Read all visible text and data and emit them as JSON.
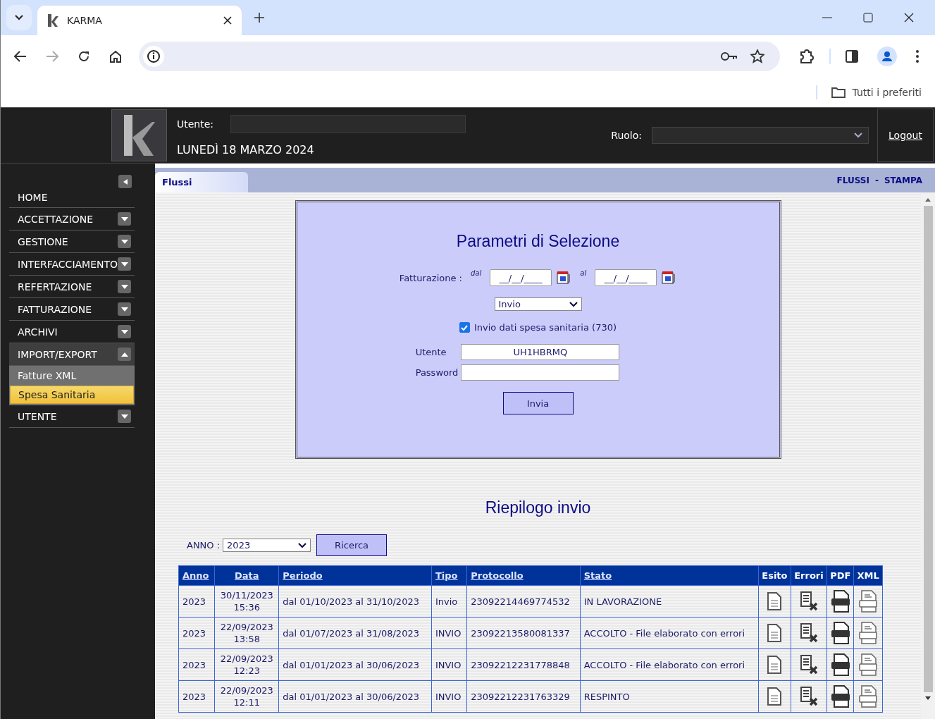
{
  "browser": {
    "tab_title": "KARMA",
    "bookmarks_label": "Tutti i preferiti"
  },
  "header": {
    "user_label": "Utente:",
    "date": "LUNEDÌ 18 MARZO 2024",
    "role_label": "Ruolo:",
    "logout": "Logout"
  },
  "sidebar": {
    "items": [
      {
        "label": "HOME",
        "kind": "link"
      },
      {
        "label": "ACCETTAZIONE",
        "kind": "menu",
        "expanded": false
      },
      {
        "label": "GESTIONE",
        "kind": "menu",
        "expanded": false
      },
      {
        "label": "INTERFACCIAMENTO",
        "kind": "menu",
        "expanded": false
      },
      {
        "label": "REFERTAZIONE",
        "kind": "menu",
        "expanded": false
      },
      {
        "label": "FATTURAZIONE",
        "kind": "menu",
        "expanded": false
      },
      {
        "label": "ARCHIVI",
        "kind": "menu",
        "expanded": false
      },
      {
        "label": "IMPORT/EXPORT",
        "kind": "menu",
        "expanded": true,
        "children": [
          {
            "label": "Fatture XML",
            "selected": false
          },
          {
            "label": "Spesa Sanitaria",
            "selected": true
          }
        ]
      },
      {
        "label": "UTENTE",
        "kind": "menu",
        "expanded": false
      }
    ]
  },
  "tabs": [
    {
      "label": "Flussi",
      "selected": true
    }
  ],
  "top_links": {
    "items": [
      "FLUSSI",
      "STAMPA"
    ],
    "separator": "-"
  },
  "form": {
    "title": "Parametri di Selezione",
    "billing_label": "Fatturazione :",
    "from_label": "dal",
    "from_value": "__/__/____",
    "to_label": "al",
    "to_value": "__/__/____",
    "type_value": "Invio",
    "checkbox": {
      "label": "Invio dati spesa sanitaria (730)",
      "checked": true
    },
    "user_label": "Utente",
    "user_value": "UH1HBRMQ",
    "password_label": "Password",
    "submit": "Invia"
  },
  "summary": {
    "title": "Riepilogo invio",
    "year_label": "ANNO :",
    "year_value": "2023",
    "search_button": "Ricerca",
    "table": {
      "columns": [
        {
          "label": "Anno",
          "kind": "sort"
        },
        {
          "label": "Data",
          "kind": "sort"
        },
        {
          "label": "Periodo",
          "kind": "sort"
        },
        {
          "label": "Tipo",
          "kind": "sort"
        },
        {
          "label": "Protocollo",
          "kind": "sort"
        },
        {
          "label": "Stato",
          "kind": "sort"
        },
        {
          "label": "Esito",
          "kind": "plain"
        },
        {
          "label": "Errori",
          "kind": "plain"
        },
        {
          "label": "PDF",
          "kind": "plain"
        },
        {
          "label": "XML",
          "kind": "plain"
        }
      ],
      "rows": [
        {
          "anno": "2023",
          "date": "30/11/2023",
          "time": "15:36",
          "periodo": "dal 01/10/2023 al 31/10/2023",
          "tipo": "Invio",
          "protocollo": "23092214469774532",
          "stato": "IN LAVORAZIONE"
        },
        {
          "anno": "2023",
          "date": "22/09/2023",
          "time": "13:58",
          "periodo": "dal 01/07/2023 al 31/08/2023",
          "tipo": "INVIO",
          "protocollo": "23092213580081337",
          "stato": "ACCOLTO - File elaborato con errori"
        },
        {
          "anno": "2023",
          "date": "22/09/2023",
          "time": "12:23",
          "periodo": "dal 01/01/2023 al 30/06/2023",
          "tipo": "INVIO",
          "protocollo": "23092212231778848",
          "stato": "ACCOLTO - File elaborato con errori"
        },
        {
          "anno": "2023",
          "date": "22/09/2023",
          "time": "12:11",
          "periodo": "dal 01/01/2023 al 30/06/2023",
          "tipo": "INVIO",
          "protocollo": "23092212231763329",
          "stato": "RESPINTO"
        }
      ]
    }
  }
}
